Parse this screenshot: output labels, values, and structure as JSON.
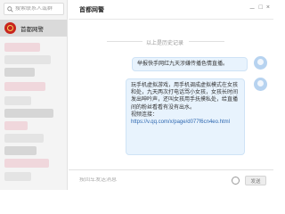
{
  "sidebar": {
    "search_placeholder": "搜索联系人或群",
    "active_contact": "首都网警"
  },
  "header": {
    "title": "首都网警",
    "controls": [
      "－",
      "□",
      "×"
    ]
  },
  "chat": {
    "history_label": "以上是历史记录",
    "bubble_1": "举报快手网红九天涉嫌传播色情直播。",
    "bubble_2": "玩手机虚拟游戏，用手机调成虚拟模式在女孩和处，九天两次打电话骂小女孩，女孩长时间发出呻吟声，还叫女孩用手抚摸私处，给直播间的粉丝看看有没有出水。",
    "video_label": "视频连接：",
    "link": "https://v.qq.com/x/page/d077f6cn4eo.html"
  },
  "input": {
    "placeholder": "按回车发送消息",
    "send_label": "发送"
  },
  "colors": {
    "badge": "#c8241d",
    "bubble_bg": "#e8f3fd",
    "link": "#2d67b0"
  }
}
